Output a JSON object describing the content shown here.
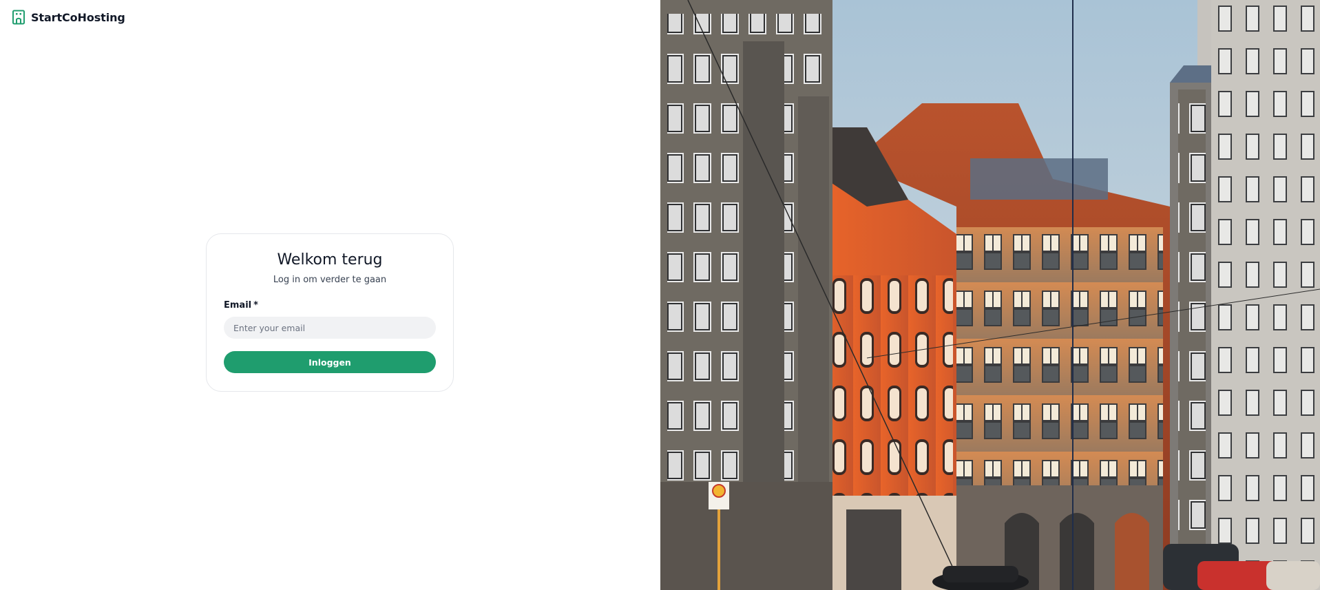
{
  "brand": {
    "name": "StartCoHosting",
    "icon": "building-icon",
    "accent": "#1f9d6e"
  },
  "login": {
    "title": "Welkom terug",
    "subtitle": "Log in om verder te gaan",
    "email_label": "Email",
    "required_marker": "*",
    "email_placeholder": "Enter your email",
    "email_value": "",
    "submit_label": "Inloggen"
  },
  "hero": {
    "image": "street-scene-photo"
  }
}
